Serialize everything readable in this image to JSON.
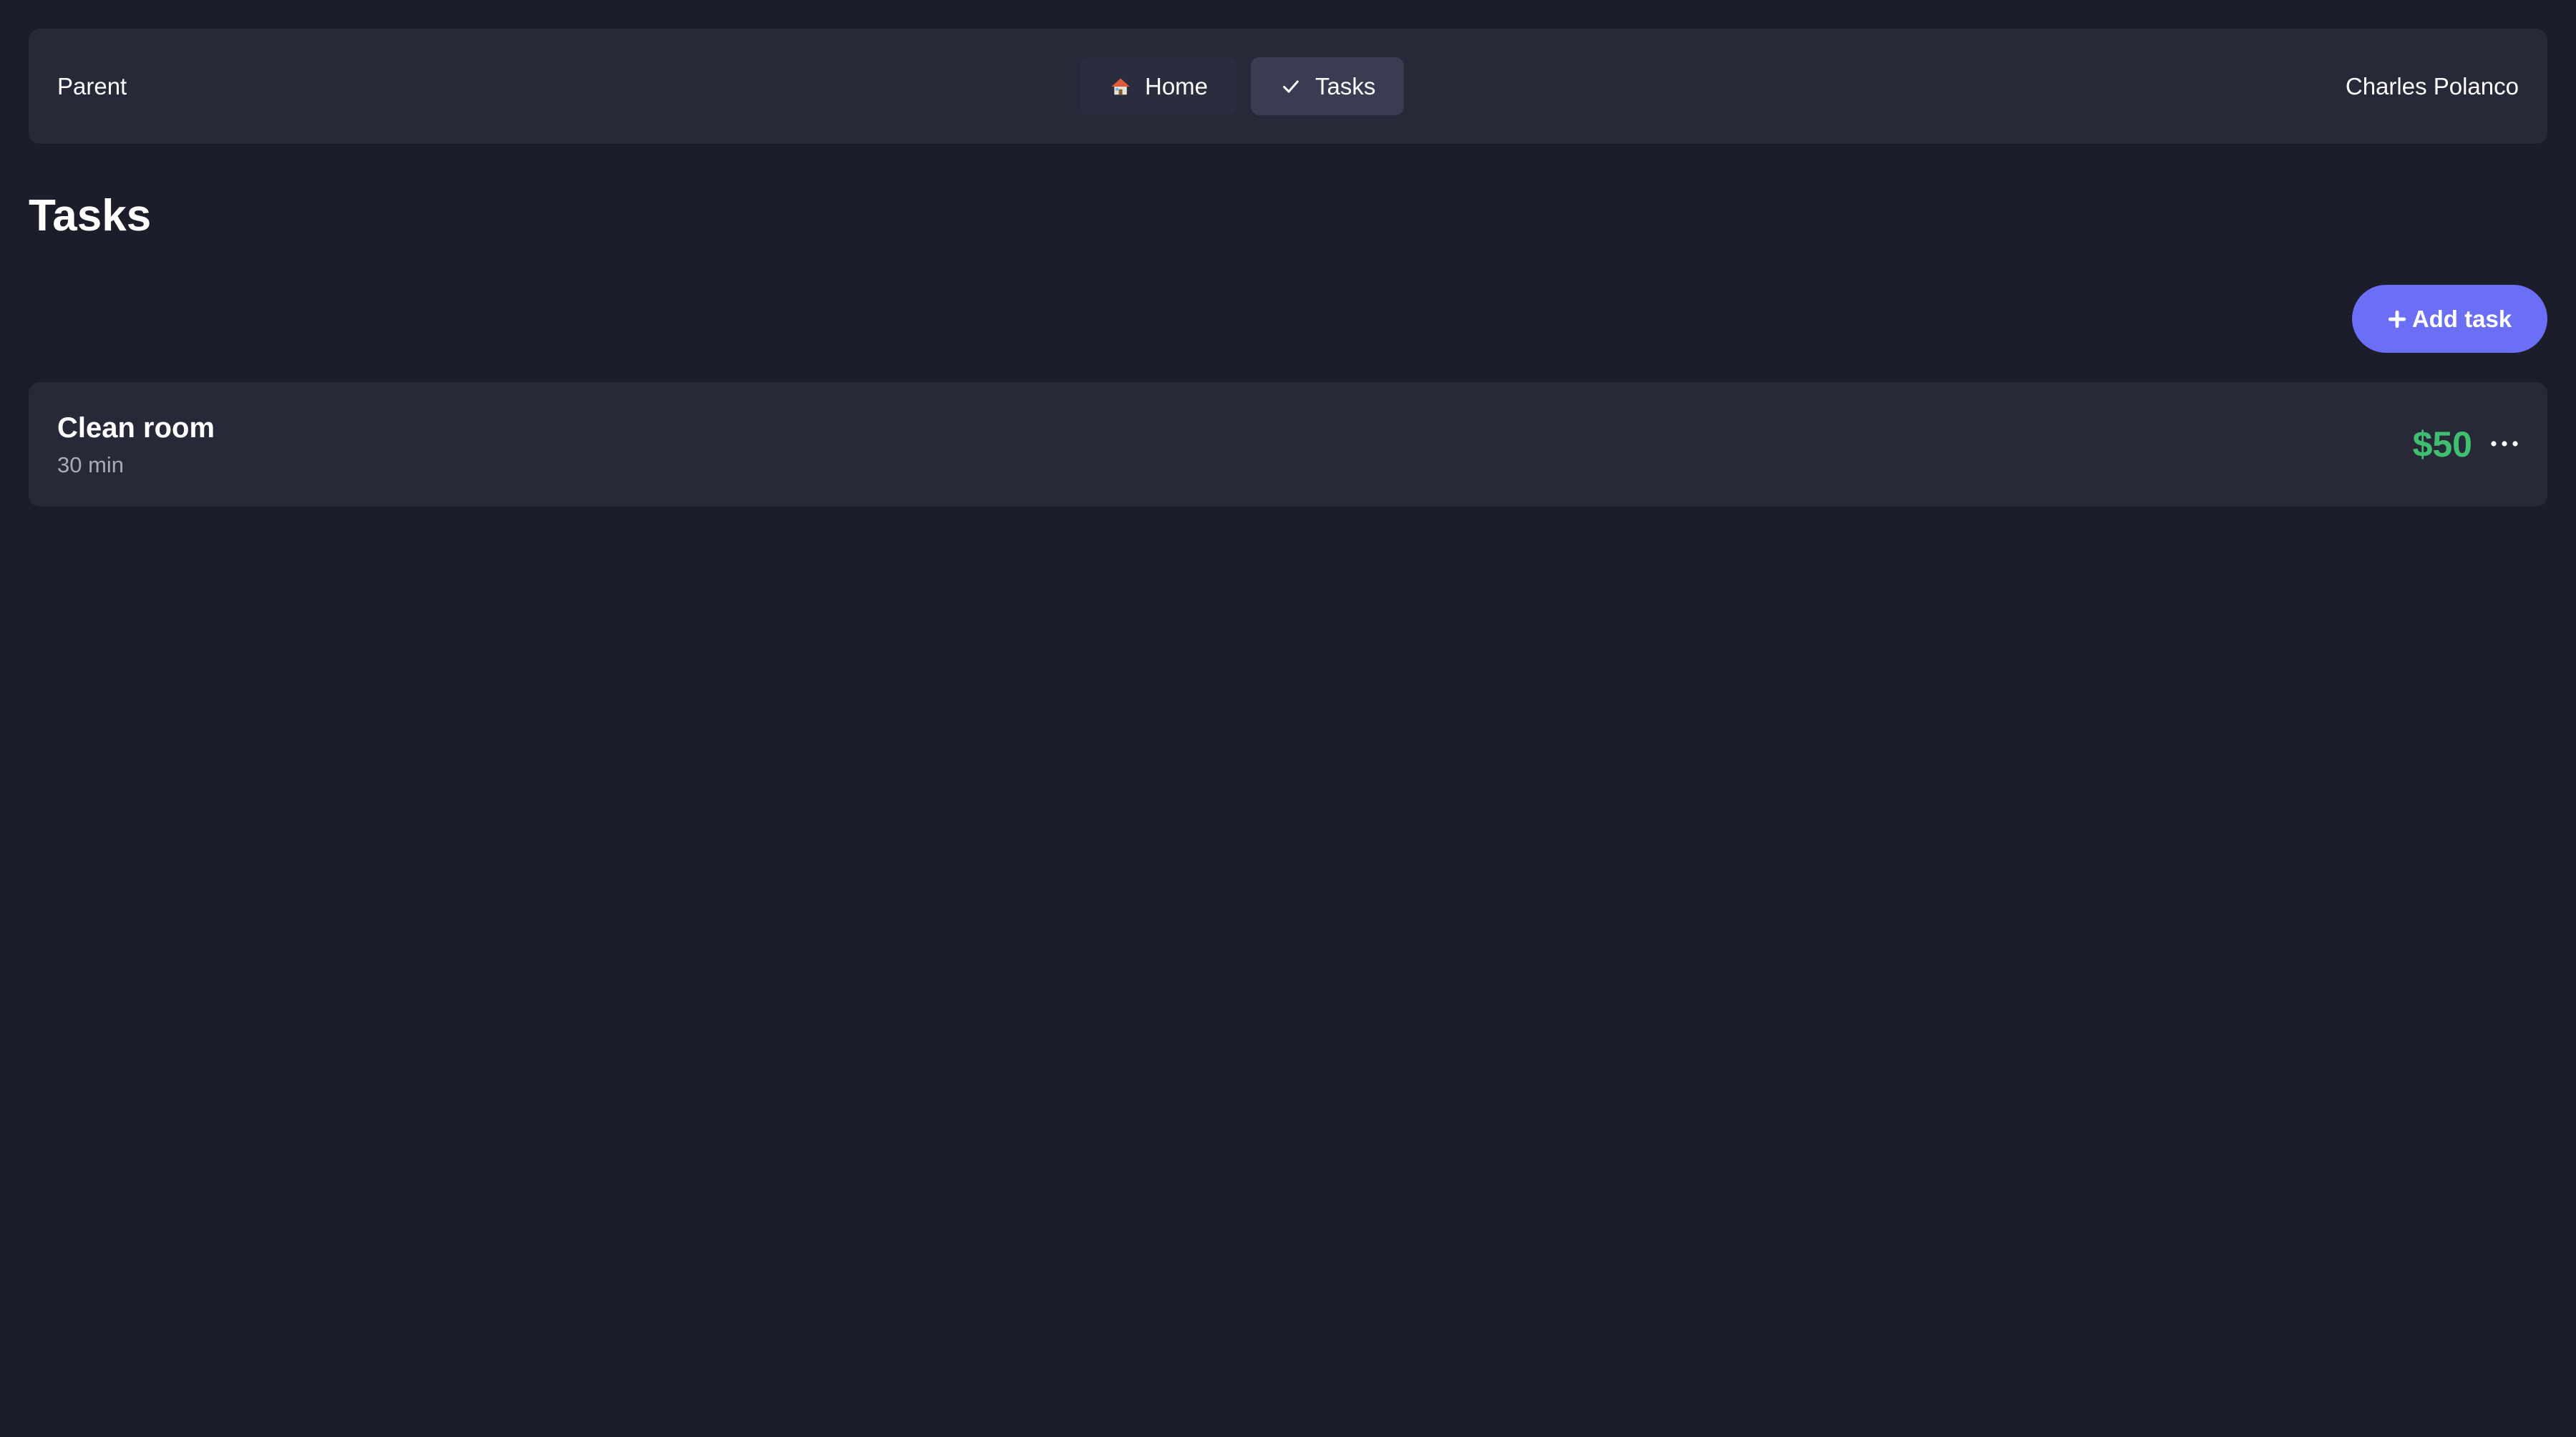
{
  "header": {
    "brand": "Parent",
    "nav": [
      {
        "label": "Home",
        "icon": "house-icon",
        "active": false
      },
      {
        "label": "Tasks",
        "icon": "checkmark-icon",
        "active": true
      }
    ],
    "user_name": "Charles Polanco"
  },
  "page": {
    "title": "Tasks",
    "add_button_label": "Add task",
    "add_button_icon": "plus-icon"
  },
  "tasks": [
    {
      "title": "Clean room",
      "duration": "30 min",
      "reward": "$50",
      "menu_icon": "more-horizontal-icon"
    }
  ],
  "colors": {
    "background": "#1c1d2b",
    "surface": "#272939",
    "accent": "#6b6ff5",
    "reward": "#3fbf6f",
    "muted_text": "#a8aab8"
  }
}
